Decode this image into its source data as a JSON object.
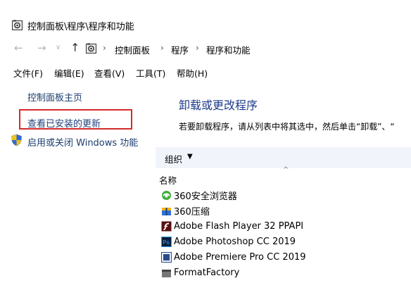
{
  "window": {
    "title": "控制面板\\程序\\程序和功能"
  },
  "address": {
    "back_icon": "←",
    "forward_icon": "→",
    "recent_icon": "∨",
    "up_icon": "↑",
    "sep": "›",
    "crumbs": [
      "控制面板",
      "程序",
      "程序和功能"
    ]
  },
  "menu": [
    "文件(F)",
    "编辑(E)",
    "查看(V)",
    "工具(T)",
    "帮助(H)"
  ],
  "left": {
    "home": "控制面板主页",
    "updates": "查看已安装的更新",
    "features": "启用或关闭 Windows 功能"
  },
  "main": {
    "title": "卸载或更改程序",
    "description": "若要卸载程序，请从列表中将其选中，然后单击“卸载”、“",
    "organize": "组织",
    "organize_arrow": "▼",
    "sort_caret": "^",
    "column_name": "名称",
    "programs": [
      {
        "name": "360安全浏览器",
        "icon": "360-browser-icon"
      },
      {
        "name": "360压缩",
        "icon": "360zip-icon"
      },
      {
        "name": "Adobe Flash Player 32 PPAPI",
        "icon": "flash-icon"
      },
      {
        "name": "Adobe Photoshop CC 2019",
        "icon": "photoshop-icon"
      },
      {
        "name": "Adobe Premiere Pro CC 2019",
        "icon": "premiere-icon"
      },
      {
        "name": "FormatFactory",
        "icon": "formatfactory-icon"
      }
    ]
  },
  "colors": {
    "highlight": "#d42b2b",
    "link": "#1c3d6e",
    "title": "#1e3a8a"
  }
}
